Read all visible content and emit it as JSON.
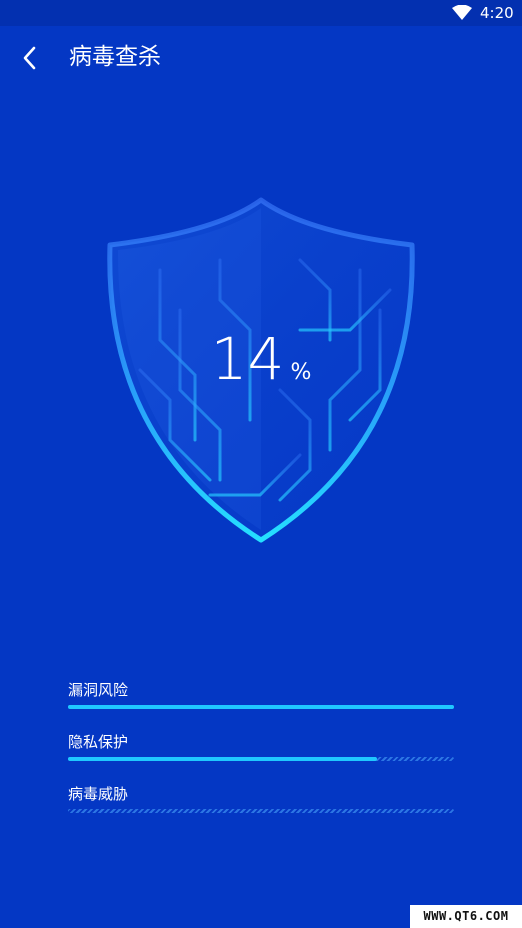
{
  "status_bar": {
    "time": "4:20",
    "wifi_icon": "wifi-icon"
  },
  "app_bar": {
    "back_icon": "chevron-left-icon",
    "title": "病毒查杀"
  },
  "scan": {
    "progress_value": "14",
    "progress_unit": "%",
    "items": [
      {
        "label": "漏洞风险",
        "progress": 1.0
      },
      {
        "label": "隐私保护",
        "progress": 0.8
      },
      {
        "label": "病毒威胁",
        "progress": 0.0
      }
    ]
  },
  "watermark": "WWW.QT6.COM",
  "colors": {
    "background": "#0437c4",
    "accent": "#1fc8ff"
  }
}
